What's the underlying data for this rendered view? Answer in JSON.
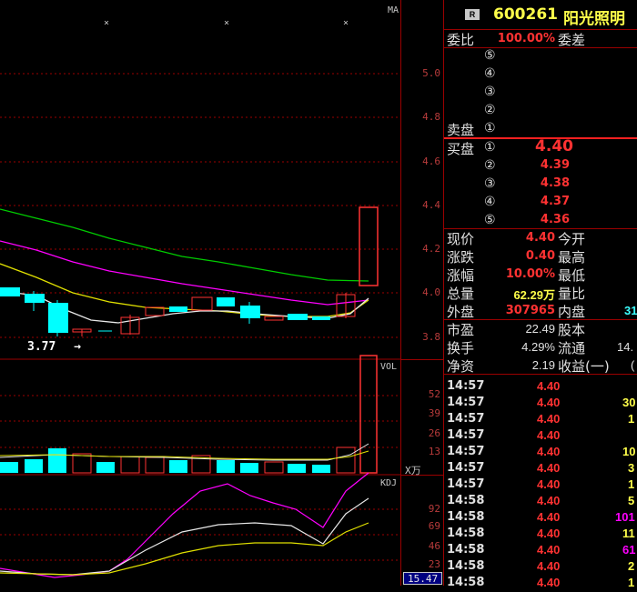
{
  "header": {
    "badge": "R",
    "code": "600261",
    "name": "阳光照明"
  },
  "ratio": {
    "label1": "委比",
    "value": "100.00%",
    "label2": "委差"
  },
  "sell": {
    "label": "卖盘",
    "levels": [
      "⑤",
      "④",
      "③",
      "②",
      "①"
    ]
  },
  "buy": {
    "label": "买盘",
    "levels": [
      {
        "num": "①",
        "price": "4.40"
      },
      {
        "num": "②",
        "price": "4.39"
      },
      {
        "num": "③",
        "price": "4.38"
      },
      {
        "num": "④",
        "price": "4.37"
      },
      {
        "num": "⑤",
        "price": "4.36"
      }
    ]
  },
  "quote": [
    {
      "l": "现价",
      "v": "4.40",
      "r": "今开"
    },
    {
      "l": "涨跌",
      "v": "0.40",
      "r": "最高"
    },
    {
      "l": "涨幅",
      "v": "10.00%",
      "r": "最低"
    },
    {
      "l": "总量",
      "v": "62.29万",
      "r": "量比"
    },
    {
      "l": "外盘",
      "v": "307965",
      "r": "内盘",
      "rv": "31"
    }
  ],
  "fund": [
    {
      "l": "市盈",
      "v": "22.49",
      "r": "股本"
    },
    {
      "l": "换手",
      "v": "4.29%",
      "r": "流通",
      "rv": "14."
    },
    {
      "l": "净资",
      "v": "2.19",
      "r": "收益(一)",
      "rv": "("
    }
  ],
  "ticks": [
    {
      "t": "14:57",
      "p": "4.40",
      "v": ""
    },
    {
      "t": "14:57",
      "p": "4.40",
      "v": "30"
    },
    {
      "t": "14:57",
      "p": "4.40",
      "v": "1"
    },
    {
      "t": "14:57",
      "p": "4.40",
      "v": ""
    },
    {
      "t": "14:57",
      "p": "4.40",
      "v": "10"
    },
    {
      "t": "14:57",
      "p": "4.40",
      "v": "3"
    },
    {
      "t": "14:57",
      "p": "4.40",
      "v": "1"
    },
    {
      "t": "14:58",
      "p": "4.40",
      "v": "5"
    },
    {
      "t": "14:58",
      "p": "4.40",
      "v": "101"
    },
    {
      "t": "14:58",
      "p": "4.40",
      "v": "11"
    },
    {
      "t": "14:58",
      "p": "4.40",
      "v": "61"
    },
    {
      "t": "14:58",
      "p": "4.40",
      "v": "2"
    },
    {
      "t": "14:58",
      "p": "4.40",
      "v": "1"
    }
  ],
  "chart": {
    "ma_label": "MA",
    "price_ticks": [
      "5.0",
      "4.8",
      "4.6",
      "4.4",
      "4.2",
      "4.0",
      "3.8"
    ],
    "low_marker": "3.77",
    "vol_label": "VOL",
    "vol_ticks": [
      "52",
      "39",
      "26",
      "13"
    ],
    "vol_unit": "X万",
    "kdj_label": "KDJ",
    "kdj_ticks": [
      "92",
      "69",
      "46",
      "23"
    ],
    "kdj_value": "15.47",
    "x_marks": [
      "×",
      "×",
      "×"
    ]
  },
  "colors": {
    "up": "#ff3232",
    "down": "#00ffff",
    "grid": "#9b0000",
    "ma_white": "#e8e8e8",
    "ma_yellow": "#ffff00",
    "ma_magenta": "#ff00ff",
    "ma_green": "#00cc00"
  }
}
